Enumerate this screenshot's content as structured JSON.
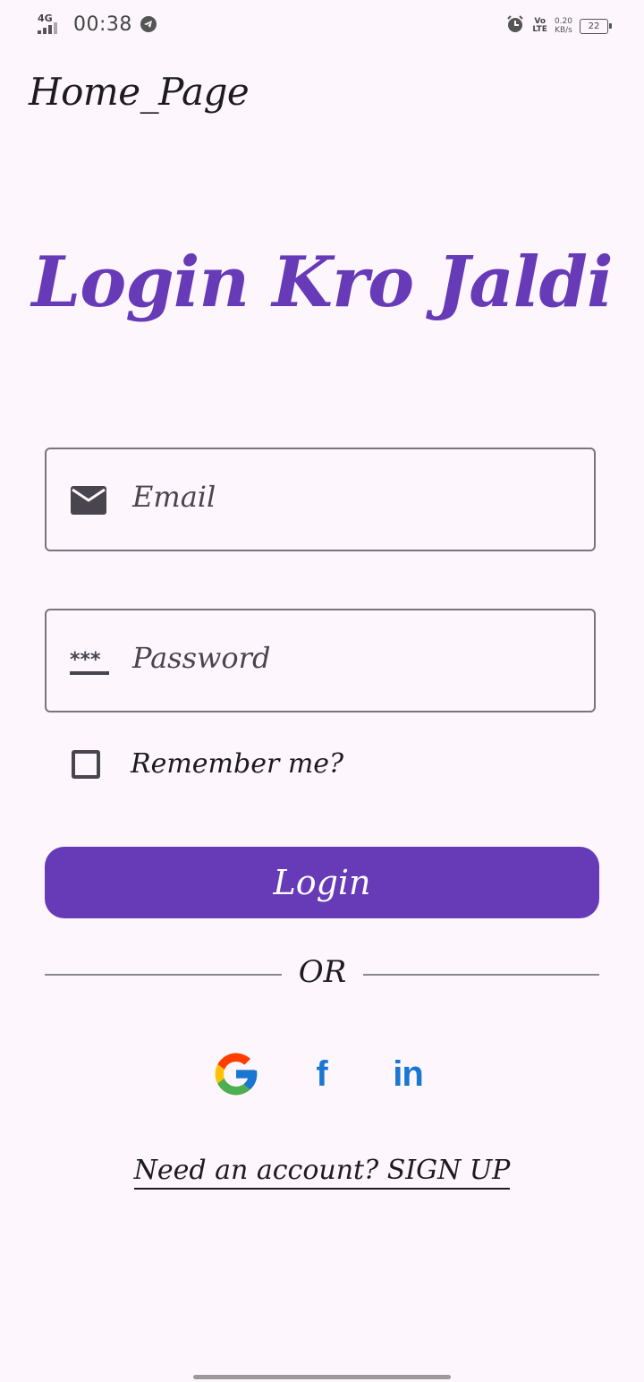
{
  "status_bar": {
    "network": "4G",
    "time": "00:38",
    "volte_top": "Vo",
    "volte_bottom": "LTE",
    "speed_value": "0.20",
    "speed_unit": "KB/s",
    "battery": "22"
  },
  "header": {
    "title": "Home_Page"
  },
  "hero": {
    "title": "Login Kro Jaldi"
  },
  "form": {
    "email_placeholder": "Email",
    "password_placeholder": "Password",
    "remember_label": "Remember me?",
    "login_label": "Login"
  },
  "divider": {
    "text": "OR"
  },
  "social": {
    "icons": [
      "google-icon",
      "facebook-icon",
      "linkedin-icon"
    ],
    "facebook_glyph": "f",
    "linkedin_glyph": "in"
  },
  "footer": {
    "signup_text": "Need an account? SIGN UP"
  },
  "colors": {
    "accent": "#673ab7",
    "background": "#fdf7fd",
    "social_blue": "#1976d2"
  }
}
